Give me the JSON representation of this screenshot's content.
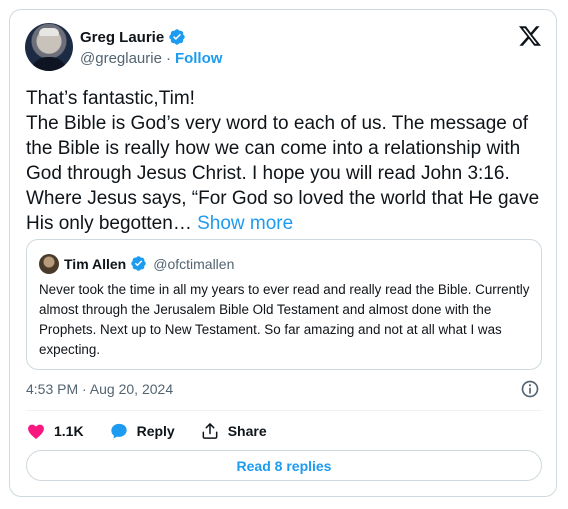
{
  "author": {
    "name": "Greg Laurie",
    "handle": "@greglaurie",
    "separator": "·",
    "follow_label": "Follow"
  },
  "tweet": {
    "lines": [
      "That’s fantastic,Tim!",
      "The Bible is God’s very word to each of us. The message of the Bible is really how we can come into a relationship with God through Jesus Christ. I hope you will read John 3:16. Where  Jesus says, “For God so loved the world that He gave His only begotten…"
    ],
    "show_more": "Show more"
  },
  "quoted": {
    "name": "Tim Allen",
    "handle": "@ofctimallen",
    "text": "Never took the time in all my years to ever read and really read the Bible. Currently almost through the Jerusalem Bible Old Testament and almost done with the Prophets. Next  up to New Testament. So far amazing and not at all what I was expecting."
  },
  "timestamp": "4:53 PM · Aug 20, 2024",
  "actions": {
    "likes": "1.1K",
    "reply_label": "Reply",
    "share_label": "Share"
  },
  "replies_button": "Read 8 replies",
  "colors": {
    "accent": "#1d9bf0",
    "like": "#f91880",
    "muted": "#536471",
    "border": "#cfd9de"
  },
  "icons": [
    "verified-badge-icon",
    "x-logo-icon",
    "info-icon",
    "heart-icon",
    "reply-bubble-icon",
    "share-icon"
  ]
}
